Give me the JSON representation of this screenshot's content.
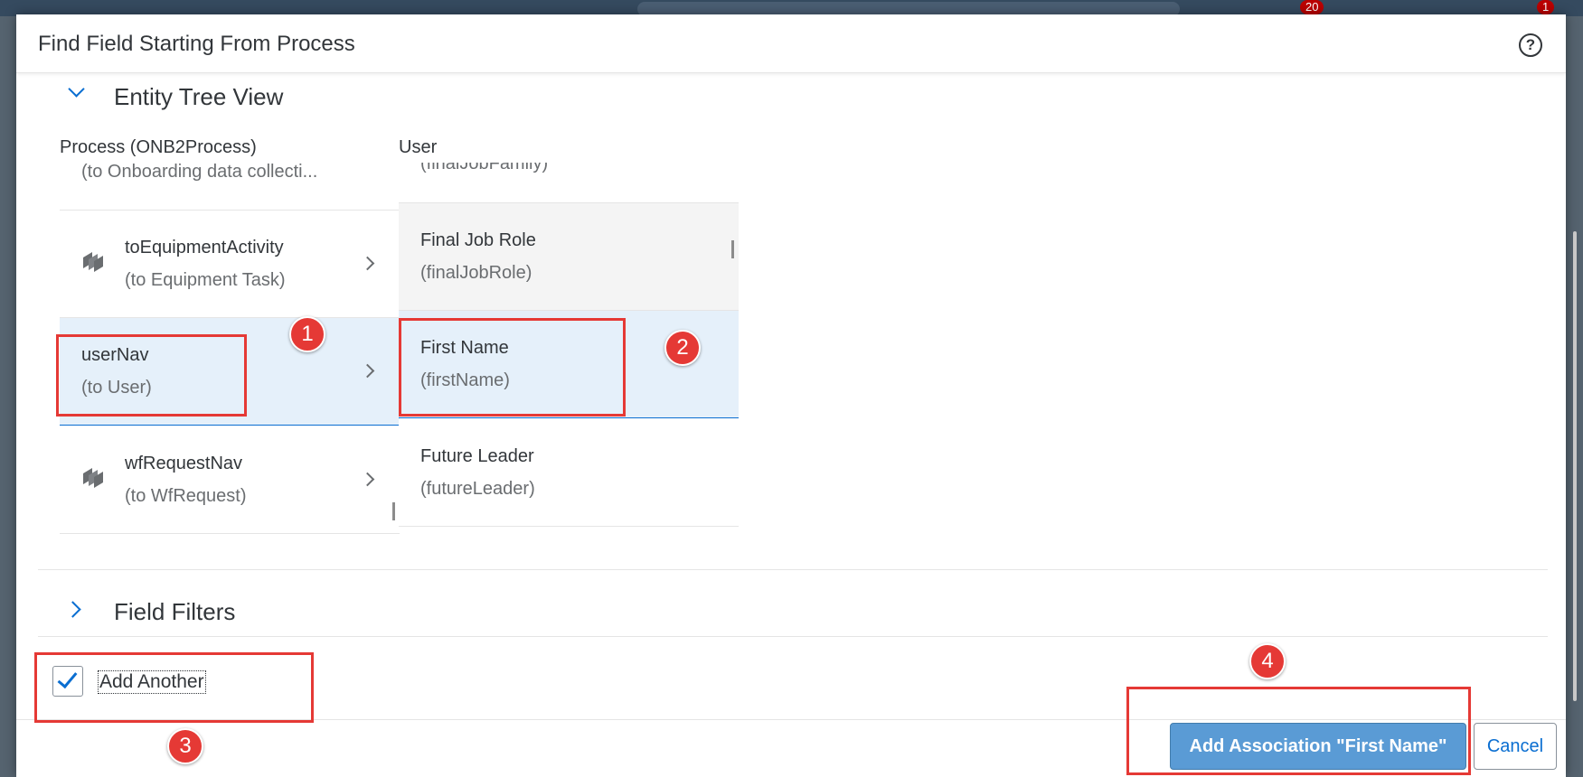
{
  "background": {
    "badge_notifications": "20",
    "badge_alerts": "1"
  },
  "dialog": {
    "title": "Find Field Starting From Process",
    "help_icon": "question-circle-icon",
    "entity_tree": {
      "section_title": "Entity Tree View",
      "left_column": {
        "header": "Process (ONB2Process)",
        "subheader": "(to Onboarding data collecti...",
        "items": [
          {
            "title": "toEquipmentActivity",
            "subtitle": "(to Equipment Task)",
            "icon": "entity-stack-icon"
          },
          {
            "title": "userNav",
            "subtitle": "(to User)",
            "selected": true
          },
          {
            "title": "wfRequestNav",
            "subtitle": "(to WfRequest)",
            "icon": "entity-stack-icon"
          }
        ]
      },
      "right_column": {
        "header": "User",
        "partial_item": "(finalJobFamily)",
        "items": [
          {
            "title": "Final Job Role",
            "subtitle": "(finalJobRole)"
          },
          {
            "title": "First Name",
            "subtitle": "(firstName)",
            "selected": true
          },
          {
            "title": "Future Leader",
            "subtitle": "(futureLeader)"
          }
        ]
      }
    },
    "field_filters": {
      "section_title": "Field Filters"
    },
    "add_another": {
      "label": "Add Another",
      "checked": true
    },
    "footer": {
      "primary_button": "Add Association \"First Name\"",
      "cancel_button": "Cancel"
    }
  },
  "annotations": [
    "1",
    "2",
    "3",
    "4"
  ],
  "colors": {
    "accent": "#0a6ed1",
    "primary_button": "#5a9bd5",
    "annotation": "#e53935",
    "selection": "#e5f0fa"
  }
}
